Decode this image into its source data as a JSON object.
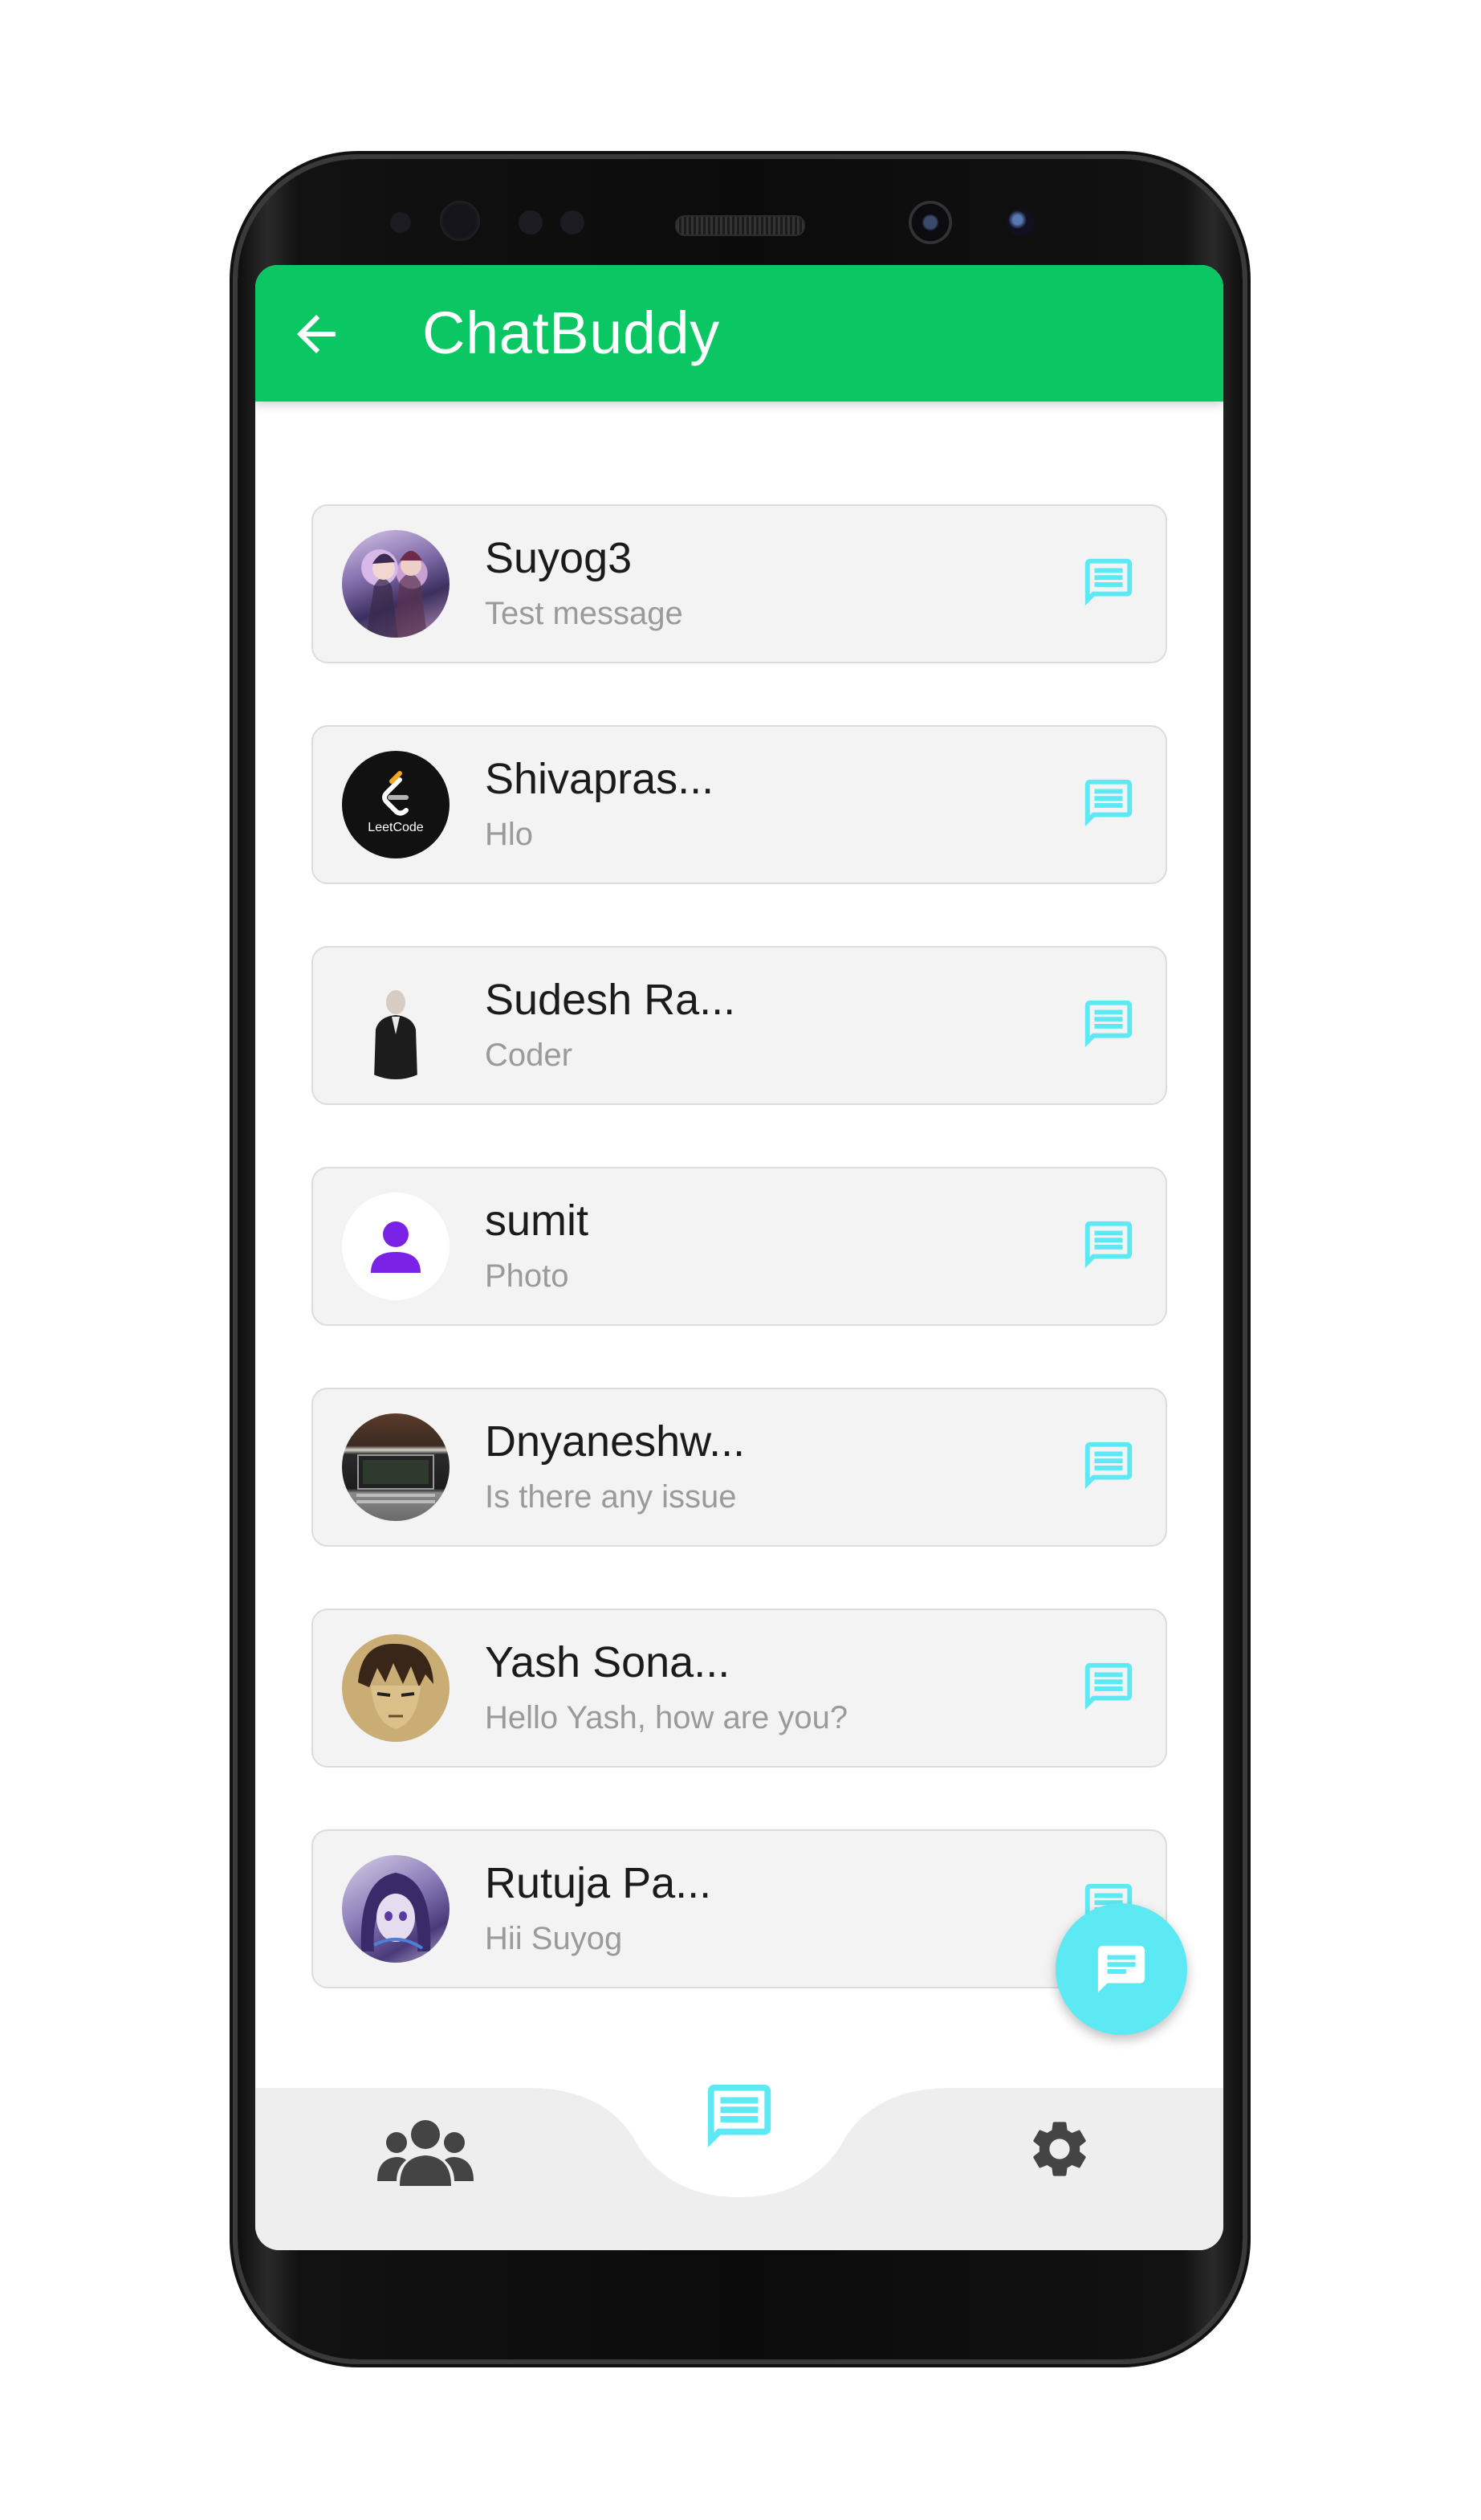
{
  "app": {
    "title": "ChatBuddy",
    "accent_color": "#0ac763",
    "fab_color": "#5de9f3"
  },
  "appbar": {
    "back_icon": "arrow-left-icon"
  },
  "chats": [
    {
      "name": "Suyog3",
      "last_message": "Test message",
      "avatar": "anime-group-avatar"
    },
    {
      "name": "Shivapras...",
      "last_message": "Hlo",
      "avatar": "leetcode-logo-avatar",
      "avatar_text": "LeetCode"
    },
    {
      "name": "Sudesh Ra...",
      "last_message": "Coder",
      "avatar": "man-in-suit-avatar"
    },
    {
      "name": "sumit",
      "last_message": "Photo",
      "avatar": "default-person-avatar"
    },
    {
      "name": "Dnyaneshw...",
      "last_message": "Is there any issue",
      "avatar": "laptop-photo-avatar"
    },
    {
      "name": "Yash Sona...",
      "last_message": "Hello Yash, how are you?",
      "avatar": "anime-boy-avatar"
    },
    {
      "name": "Rutuja Pa...",
      "last_message": "Hii Suyog",
      "avatar": "anime-girl-avatar"
    }
  ],
  "fab": {
    "icon": "new-message-icon"
  },
  "bottom_nav": {
    "items": [
      {
        "id": "groups",
        "icon": "group-icon",
        "active": false
      },
      {
        "id": "chats",
        "icon": "chat-icon",
        "active": true
      },
      {
        "id": "settings",
        "icon": "gear-icon",
        "active": false
      }
    ]
  }
}
